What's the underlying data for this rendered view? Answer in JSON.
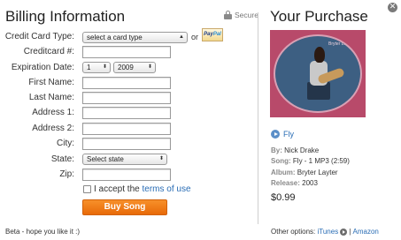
{
  "billing": {
    "title": "Billing Information",
    "secure_label": "Secure",
    "labels": {
      "card_type": "Credit Card Type:",
      "card_number": "Creditcard #:",
      "expiration": "Expiration Date:",
      "first_name": "First Name:",
      "last_name": "Last Name:",
      "address1": "Address 1:",
      "address2": "Address 2:",
      "city": "City:",
      "state": "State:",
      "zip": "Zip:"
    },
    "card_type_value": "select a card type",
    "or_label": "or",
    "paypal_pay": "Pay",
    "paypal_pal": "Pal",
    "exp_month": "1",
    "exp_year": "2009",
    "state_value": "Select state",
    "accept_prefix": "I accept the ",
    "terms_link": "terms of use",
    "buy_button": "Buy Song",
    "beta_note": "Beta - hope you like it :)"
  },
  "purchase": {
    "title": "Your Purchase",
    "album_text": "Bryter Layter",
    "song_link": "Fly",
    "by_key": "By:",
    "by_value": "Nick Drake",
    "song_key": "Song:",
    "song_value": "Fly - 1 MP3 (2:59)",
    "album_key": "Album:",
    "album_value": "Bryter Layter",
    "release_key": "Release:",
    "release_value": "2003",
    "price": "$0.99",
    "other_label": "Other options:",
    "itunes_link": "iTunes",
    "separator": "|",
    "amazon_link": "Amazon"
  },
  "icons": {
    "close": "close-icon",
    "lock": "lock-icon",
    "play": "play-icon",
    "arrow": "arrow-right-icon"
  },
  "colors": {
    "accent_orange": "#f07d1a",
    "link_blue": "#2a6db5"
  }
}
